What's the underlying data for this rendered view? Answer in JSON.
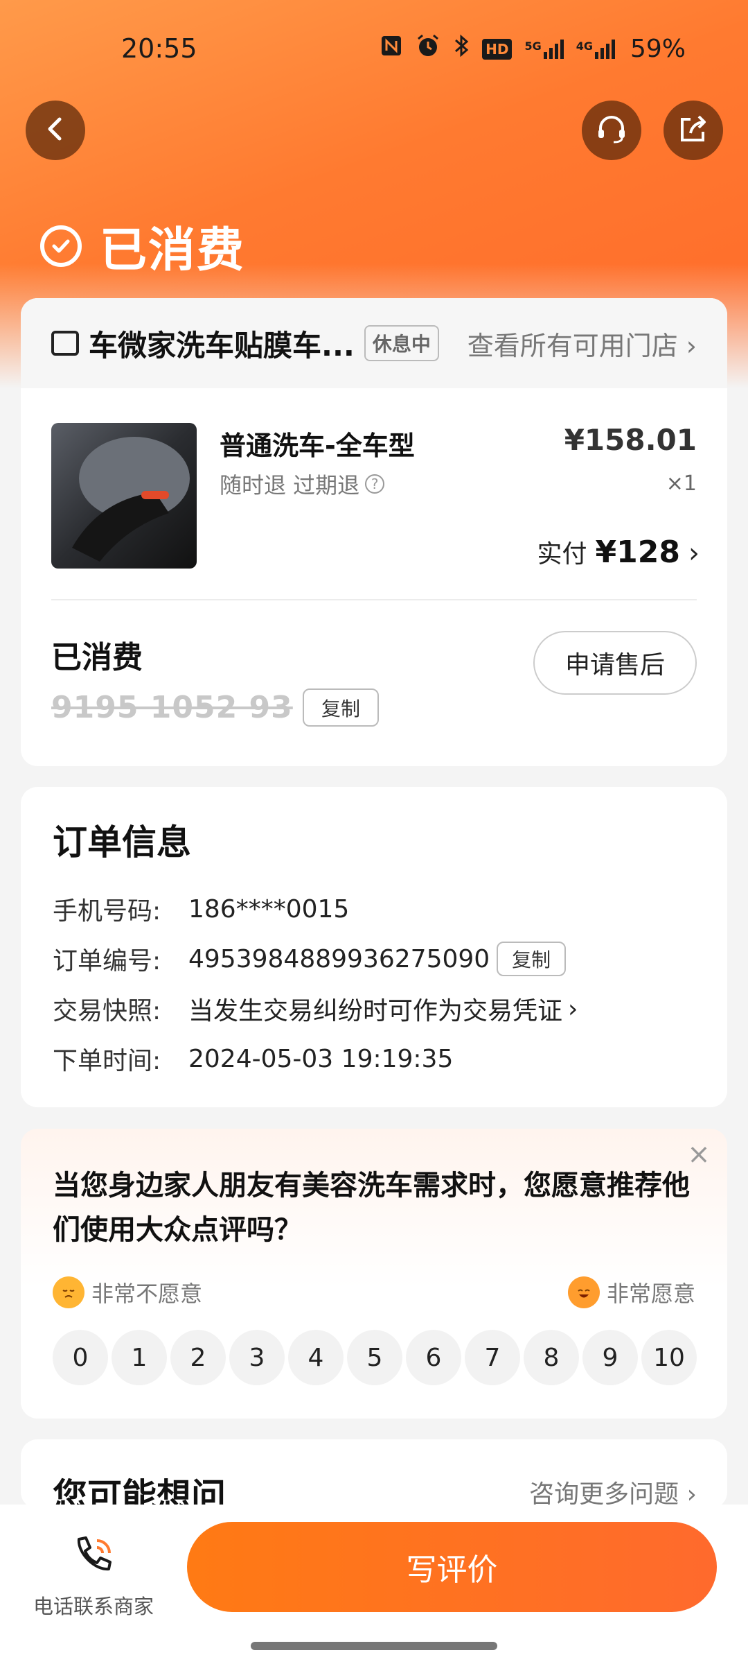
{
  "status_bar": {
    "time": "20:55",
    "icons": [
      "nfc-icon",
      "alarm-icon",
      "bluetooth-icon",
      "hd-icon",
      "5g-signal-icon",
      "4g-signal-icon"
    ],
    "hd_label": "HD",
    "sig5g_label": "5G",
    "sig4g_label": "4G",
    "battery": "59%"
  },
  "header": {
    "status_title": "已消费",
    "accent": "#ff7a2f"
  },
  "store": {
    "name": "车微家洗车贴膜车...",
    "badge": "休息中",
    "link": "查看所有可用门店"
  },
  "product": {
    "name": "普通洗车-全车型",
    "refund_terms": "随时退 过期退",
    "price": "¥158.01",
    "quantity": "×1",
    "paid_label": "实付",
    "paid_amount": "¥128"
  },
  "voucher": {
    "status": "已消费",
    "code": "9195 1052 93",
    "copy_label": "复制",
    "after_sale_label": "申请售后"
  },
  "order_info": {
    "title": "订单信息",
    "rows": [
      {
        "label": "手机号码:",
        "value": "186****0015"
      },
      {
        "label": "订单编号:",
        "value": "4953984889936275090"
      },
      {
        "label": "交易快照:",
        "value": "当发生交易纠纷时可作为交易凭证"
      },
      {
        "label": "下单时间:",
        "value": "2024-05-03 19:19:35"
      }
    ],
    "copy_label": "复制"
  },
  "survey": {
    "question": "当您身边家人朋友有美容洗车需求时，您愿意推荐他们使用大众点评吗？",
    "low_label": "非常不愿意",
    "high_label": "非常愿意",
    "scale": [
      "0",
      "1",
      "2",
      "3",
      "4",
      "5",
      "6",
      "7",
      "8",
      "9",
      "10"
    ]
  },
  "faq": {
    "title": "您可能想问",
    "link": "咨询更多问题"
  },
  "bottom": {
    "phone_label": "电话联系商家",
    "review_label": "写评价"
  }
}
